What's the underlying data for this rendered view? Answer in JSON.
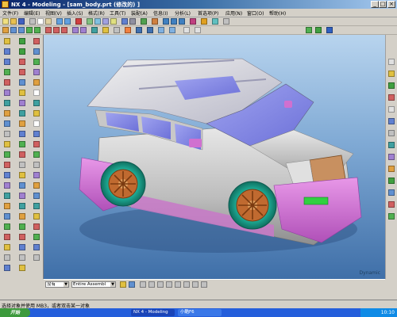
{
  "window": {
    "title": "NX 4 - Modeling - [sam_body.prt (修改的) ]",
    "minimize_glyph": "_",
    "maximize_glyph": "□",
    "close_glyph": "×"
  },
  "menubar": {
    "items": [
      "文件(F)",
      "编辑(E)",
      "视图(V)",
      "插入(S)",
      "格式(R)",
      "工具(T)",
      "装配(A)",
      "信息(I)",
      "分析(L)",
      "首选项(P)",
      "应用(N)",
      "窗口(O)",
      "帮助(H)"
    ]
  },
  "bottom_toolbar": {
    "filter_label": "没有",
    "scope_label": "Entire Assembl"
  },
  "statusbar": {
    "message": "选择对象并使用 MB3，或者双击某一对象"
  },
  "taskbar": {
    "start_label": "开始",
    "tasks": [
      "NX 4 - Modeling",
      "小酷F6"
    ],
    "clock": "10:10"
  },
  "viewport": {
    "label": "Dynamic"
  },
  "colors": {
    "title_gradient_start": "#0a246a",
    "body_silver": "#c8c8c8",
    "bumper_magenta": "#d070d0",
    "wheel_teal": "#1aa090",
    "rim_bronze": "#c06a30",
    "glass_blue": "#8a8ee8",
    "viewport_top": "#b8d4ee",
    "viewport_bottom": "#3f6fa8"
  }
}
